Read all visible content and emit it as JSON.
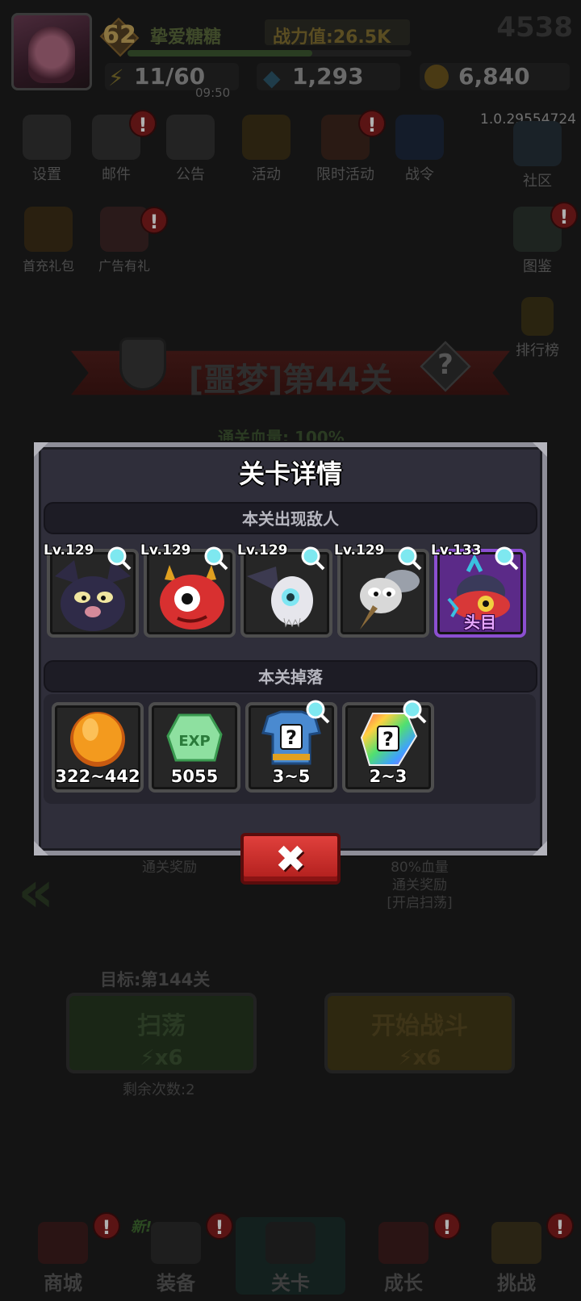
{
  "player": {
    "level": "62",
    "name": "挚爱糖糖",
    "power_label": "战力值:",
    "power_value": "26.5K",
    "exp_percent": 65,
    "corner_number": "4538",
    "energy": "11/60",
    "energy_timer": "09:50",
    "diamonds": "1,293",
    "gold": "6,840"
  },
  "version": "1.0.29554724",
  "menu": {
    "top_row": [
      {
        "label": "设置",
        "icon": "gear-icon",
        "alert": false
      },
      {
        "label": "邮件",
        "icon": "mail-icon",
        "alert": true
      },
      {
        "label": "公告",
        "icon": "notice-board-icon",
        "alert": false
      },
      {
        "label": "活动",
        "icon": "crown-icon",
        "alert": false
      },
      {
        "label": "限时活动",
        "icon": "lantern-icon",
        "alert": true
      },
      {
        "label": "战令",
        "icon": "battle-flag-icon",
        "alert": false
      },
      {
        "label": "社区",
        "icon": "home-icon",
        "alert": false
      }
    ],
    "second_row": [
      {
        "label": "首充礼包",
        "icon": "treasure-chest-icon",
        "alert": false
      },
      {
        "label": "广告有礼",
        "icon": "gift-box-icon",
        "alert": true
      },
      {
        "label": "图鉴",
        "icon": "book-icon",
        "alert": true
      }
    ],
    "leaderboard": {
      "label": "排行榜",
      "icon": "trophy-icon"
    }
  },
  "stage": {
    "title": "[噩梦]第44关",
    "clear_hp": "通关血量: 100%",
    "behind_left": "通关奖励",
    "behind_right_1": "80%血量",
    "behind_right_2": "通关奖励",
    "behind_right_3": "[开启扫荡]",
    "target": "目标:第144关",
    "sweep_label": "扫荡",
    "sweep_cost": "x6",
    "fight_label": "开始战斗",
    "fight_cost": "x6",
    "remaining": "剩余次数:2"
  },
  "modal": {
    "title": "关卡详情",
    "enemies_header": "本关出现敌人",
    "enemies": [
      {
        "level": "Lv.129",
        "icon": "bat-enemy-icon",
        "boss": false
      },
      {
        "level": "Lv.129",
        "icon": "red-devil-enemy-icon",
        "boss": false
      },
      {
        "level": "Lv.129",
        "icon": "bat-skull-enemy-icon",
        "boss": false
      },
      {
        "level": "Lv.129",
        "icon": "mosquito-enemy-icon",
        "boss": false
      },
      {
        "level": "Lv.133",
        "icon": "beetle-boss-icon",
        "boss": true,
        "boss_label": "头目"
      }
    ],
    "drops_header": "本关掉落",
    "drops": [
      {
        "count": "322~442",
        "icon": "gold-coin-icon"
      },
      {
        "count": "5055",
        "icon": "exp-crystal-icon",
        "text": "EXP"
      },
      {
        "count": "3~5",
        "icon": "mystery-armor-icon",
        "text": "?"
      },
      {
        "count": "2~3",
        "icon": "rainbow-gem-icon",
        "text": "?"
      }
    ],
    "close_symbol": "✖"
  },
  "bottom_nav": {
    "new_tag": "新!",
    "items": [
      {
        "label": "商城",
        "icon": "shop-icon",
        "alert": true
      },
      {
        "label": "装备",
        "icon": "equipment-icon",
        "alert": true
      },
      {
        "label": "关卡",
        "icon": "stage-skull-icon",
        "alert": false
      },
      {
        "label": "成长",
        "icon": "growth-icon",
        "alert": true
      },
      {
        "label": "挑战",
        "icon": "crossed-swords-icon",
        "alert": true
      }
    ]
  }
}
